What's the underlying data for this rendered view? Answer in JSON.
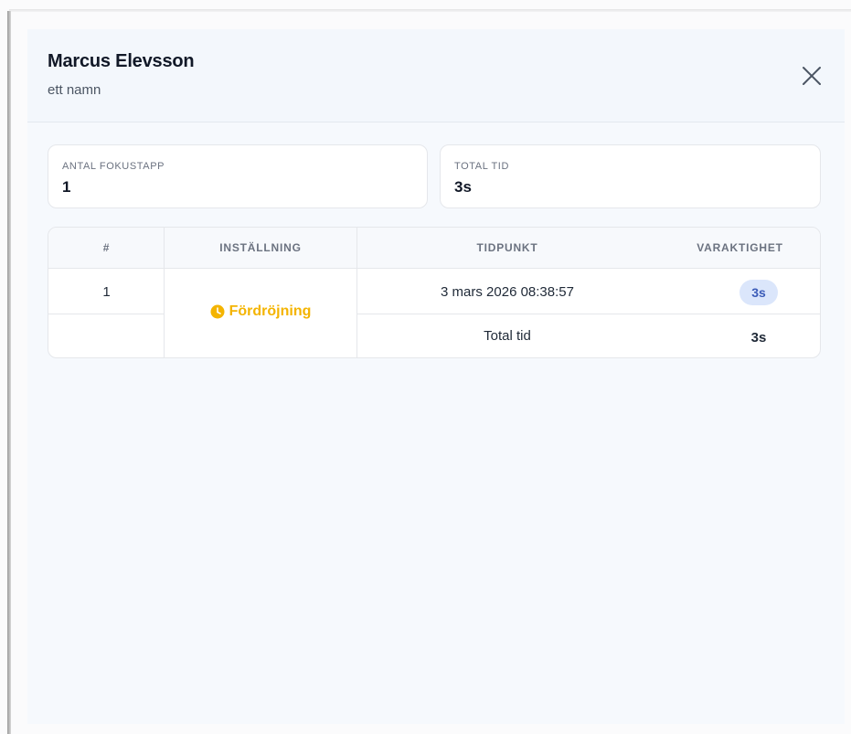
{
  "header": {
    "title": "Marcus Elevsson",
    "subtitle": "ett namn"
  },
  "stats": {
    "focus_loss_label": "ANTAL FOKUSTAPP",
    "focus_loss_value": "1",
    "total_time_label": "TOTAL TID",
    "total_time_value": "3s"
  },
  "table": {
    "headers": [
      "#",
      "INSTÄLLNING",
      "TIDPUNKT",
      "VARAKTIGHET"
    ],
    "rows": [
      {
        "index": "1",
        "timestamp": "3 mars 2026 08:38:57",
        "duration": "3s"
      }
    ],
    "setting": "Fördröjning",
    "total_label": "Total tid",
    "total_value": "3s"
  },
  "colors": {
    "setting_accent": "#f4b400",
    "badge_bg": "#dbe6fb",
    "badge_text": "#3b5bb8"
  },
  "icons": {
    "close": "close-icon",
    "setting": "clock-icon"
  }
}
